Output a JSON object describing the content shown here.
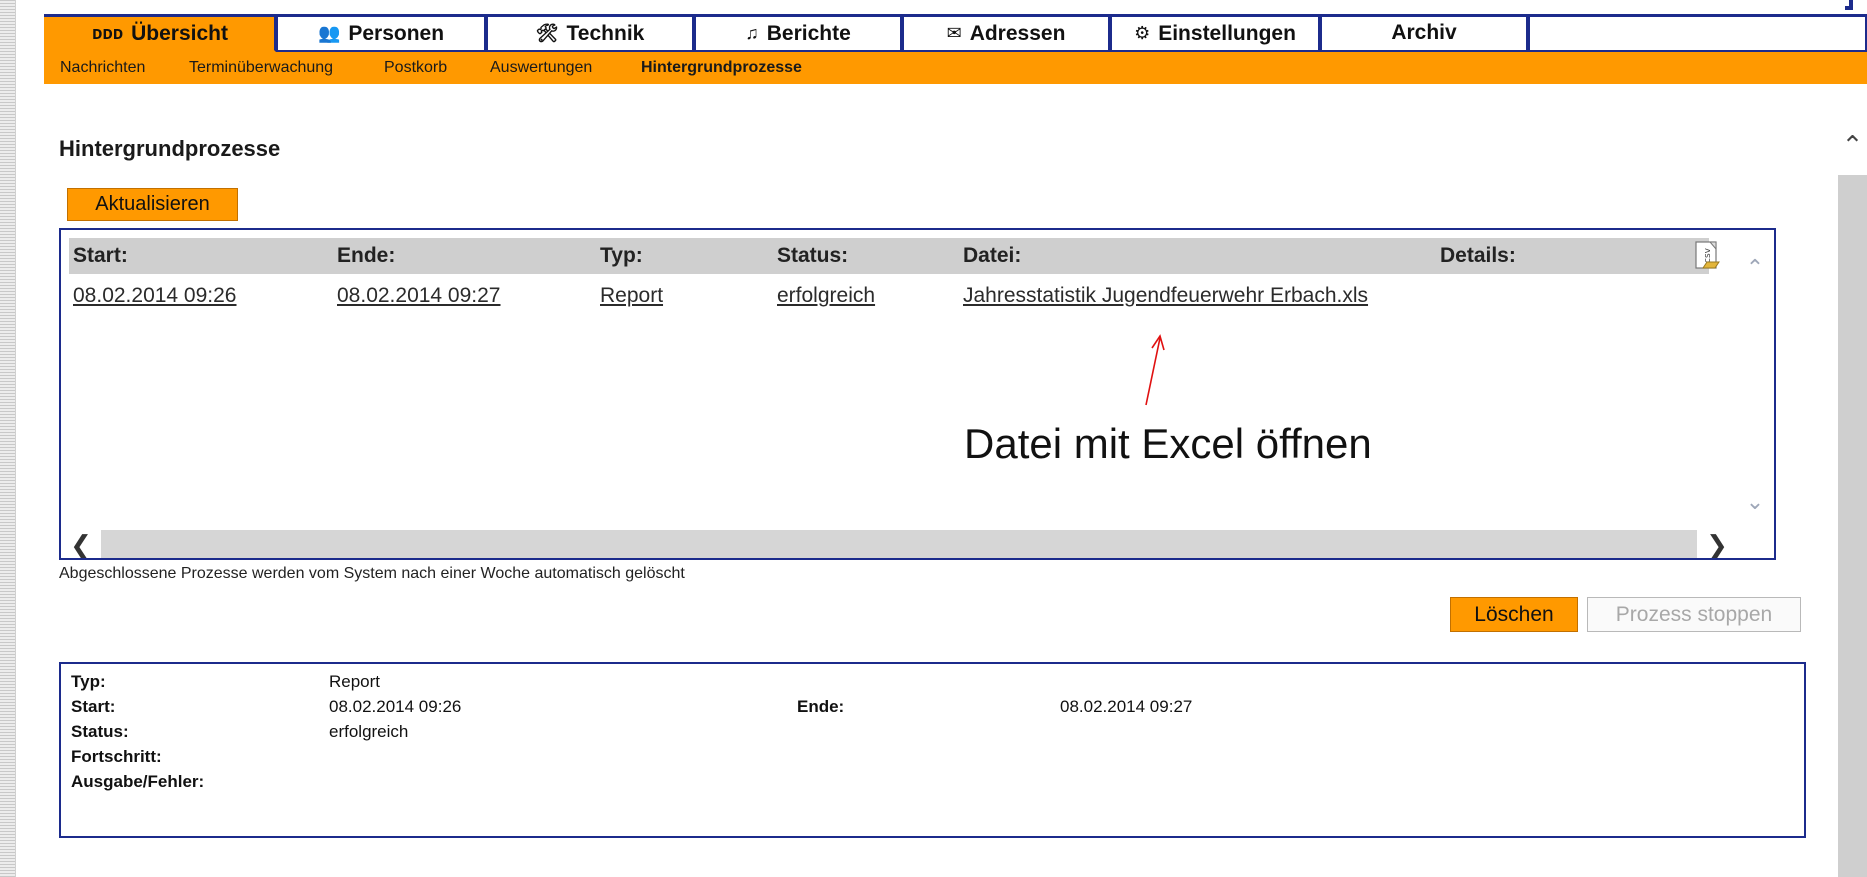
{
  "tabs": [
    {
      "icon": "ᴅᴅᴅ",
      "label": "Übersicht",
      "active": true
    },
    {
      "icon": "👥",
      "label": "Personen",
      "active": false
    },
    {
      "icon": "🛠",
      "label": "Technik",
      "active": false
    },
    {
      "icon": "♫",
      "label": "Berichte",
      "active": false
    },
    {
      "icon": "✉",
      "label": "Adressen",
      "active": false
    },
    {
      "icon": "⚙",
      "label": "Einstellungen",
      "active": false
    },
    {
      "icon": "",
      "label": "Archiv",
      "active": false
    },
    {
      "icon": "",
      "label": "",
      "active": false
    }
  ],
  "subnav": {
    "items": [
      "Nachrichten",
      "Terminüberwachung",
      "Postkorb",
      "Auswertungen",
      "Hintergrundprozesse"
    ],
    "current": "Hintergrundprozesse"
  },
  "page": {
    "title": "Hintergrundprozesse",
    "refresh_label": "Aktualisieren",
    "note": "Abgeschlossene Prozesse werden vom System nach einer Woche automatisch gelöscht",
    "delete_label": "Löschen",
    "stop_label": "Prozess stoppen"
  },
  "process_table": {
    "headers": [
      "Start:",
      "Ende:",
      "Typ:",
      "Status:",
      "Datei:",
      "Details:"
    ],
    "rows": [
      {
        "start": "08.02.2014 09:26",
        "end": "08.02.2014 09:27",
        "type": "Report",
        "status": "erfolgreich",
        "file": "Jahresstatistik Jugendfeuerwehr Erbach.xls",
        "details": ""
      }
    ],
    "export_icon_label": "csv"
  },
  "annotation": {
    "text": "Datei mit Excel öffnen",
    "color": "#e01010"
  },
  "details": {
    "type_label": "Typ:",
    "type_value": "Report",
    "start_label": "Start:",
    "start_value": "08.02.2014 09:26",
    "end_label": "Ende:",
    "end_value": "08.02.2014 09:27",
    "status_label": "Status:",
    "status_value": "erfolgreich",
    "progress_label": "Fortschritt:",
    "progress_value": "",
    "output_label": "Ausgabe/Fehler:",
    "output_value": ""
  },
  "colors": {
    "accent": "#ff9900",
    "border": "#1c2b8c",
    "header_bg": "#cfcfcf"
  }
}
